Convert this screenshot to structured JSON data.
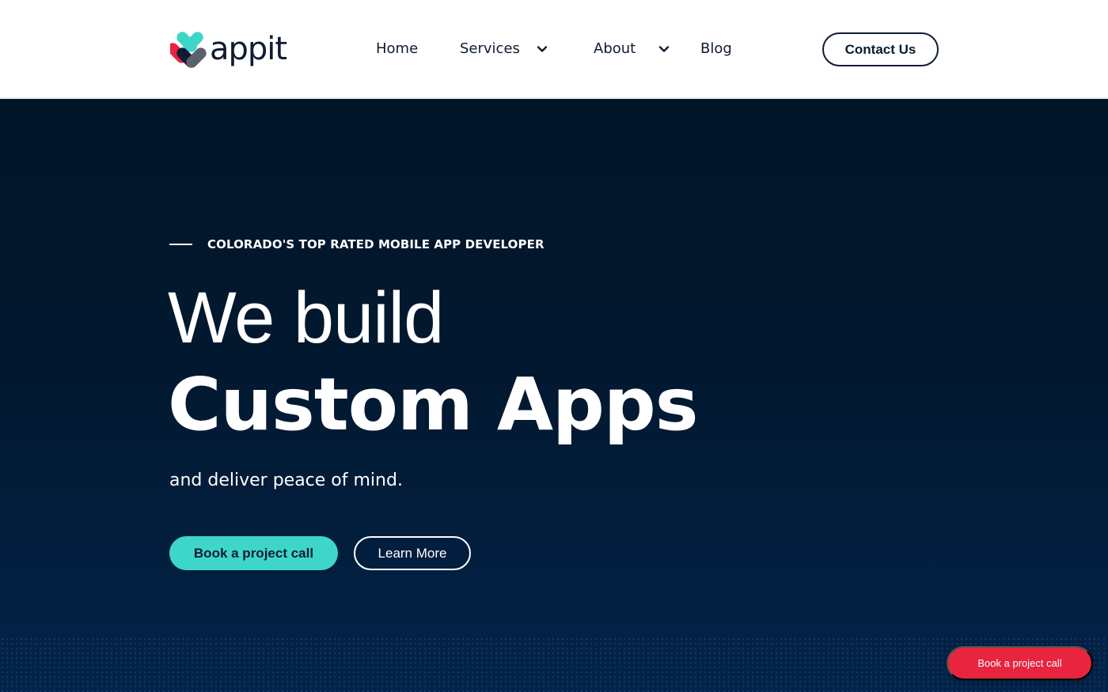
{
  "brand": {
    "name": "appit"
  },
  "nav": {
    "items": [
      {
        "label": "Home",
        "has_dropdown": false
      },
      {
        "label": "Services",
        "has_dropdown": true
      },
      {
        "label": "About",
        "has_dropdown": true
      },
      {
        "label": "Blog",
        "has_dropdown": false
      }
    ],
    "contact_label": "Contact Us"
  },
  "hero": {
    "eyebrow": "COLORADO'S TOP RATED MOBILE APP DEVELOPER",
    "headline_light": "We build",
    "headline_bold": "Custom Apps",
    "subline": "and deliver peace of mind.",
    "primary_cta": "Book a project call",
    "secondary_cta": "Learn More"
  },
  "floating_cta": {
    "label": "Book a project call"
  },
  "colors": {
    "navy": "#0e1b33",
    "hero_bg": "#02182f",
    "teal": "#3ed6c9",
    "red": "#e8243f"
  }
}
